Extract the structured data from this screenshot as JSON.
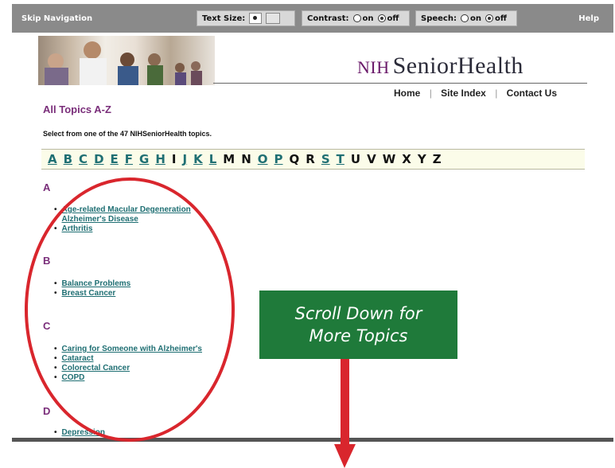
{
  "toolbar": {
    "skip_label": "Skip Navigation",
    "text_size_label": "Text Size:",
    "contrast_label": "Contrast:",
    "contrast_on": "on",
    "contrast_off": "off",
    "speech_label": "Speech:",
    "speech_on": "on",
    "speech_off": "off",
    "help_label": "Help"
  },
  "logo": {
    "nih": "NIH",
    "name": "SeniorHealth"
  },
  "nav": {
    "home": "Home",
    "site_index": "Site Index",
    "contact": "Contact Us",
    "separator": "|"
  },
  "page_title": "All Topics A-Z",
  "intro": "Select from one of the 47 NIHSeniorHealth topics.",
  "alphabet": [
    {
      "letter": "A",
      "link": true
    },
    {
      "letter": "B",
      "link": true
    },
    {
      "letter": "C",
      "link": true
    },
    {
      "letter": "D",
      "link": true
    },
    {
      "letter": "E",
      "link": true
    },
    {
      "letter": "F",
      "link": true
    },
    {
      "letter": "G",
      "link": true
    },
    {
      "letter": "H",
      "link": true
    },
    {
      "letter": "I",
      "link": false
    },
    {
      "letter": "J",
      "link": true
    },
    {
      "letter": "K",
      "link": true
    },
    {
      "letter": "L",
      "link": true
    },
    {
      "letter": "M",
      "link": false
    },
    {
      "letter": "N",
      "link": false
    },
    {
      "letter": "O",
      "link": true
    },
    {
      "letter": "P",
      "link": true
    },
    {
      "letter": "Q",
      "link": false
    },
    {
      "letter": "R",
      "link": false
    },
    {
      "letter": "S",
      "link": true
    },
    {
      "letter": "T",
      "link": true
    },
    {
      "letter": "U",
      "link": false
    },
    {
      "letter": "V",
      "link": false
    },
    {
      "letter": "W",
      "link": false
    },
    {
      "letter": "X",
      "link": false
    },
    {
      "letter": "Y",
      "link": false
    },
    {
      "letter": "Z",
      "link": false
    }
  ],
  "sections": {
    "a": {
      "letter": "A",
      "topics": [
        "Age-related Macular Degeneration",
        "Alzheimer's Disease",
        "Arthritis"
      ]
    },
    "b": {
      "letter": "B",
      "topics": [
        "Balance Problems",
        "Breast Cancer"
      ]
    },
    "c": {
      "letter": "C",
      "topics": [
        "Caring for Someone with Alzheimer's",
        "Cataract",
        "Colorectal Cancer",
        "COPD"
      ]
    },
    "d": {
      "letter": "D",
      "topics": [
        "Depression"
      ]
    }
  },
  "callout": {
    "line1": "Scroll Down for",
    "line2": "More Topics"
  },
  "colors": {
    "callout_bg": "#1f7a3a",
    "annotation_red": "#d9262d",
    "heading_purple": "#7a2e7a",
    "link_teal": "#1f6f73"
  }
}
